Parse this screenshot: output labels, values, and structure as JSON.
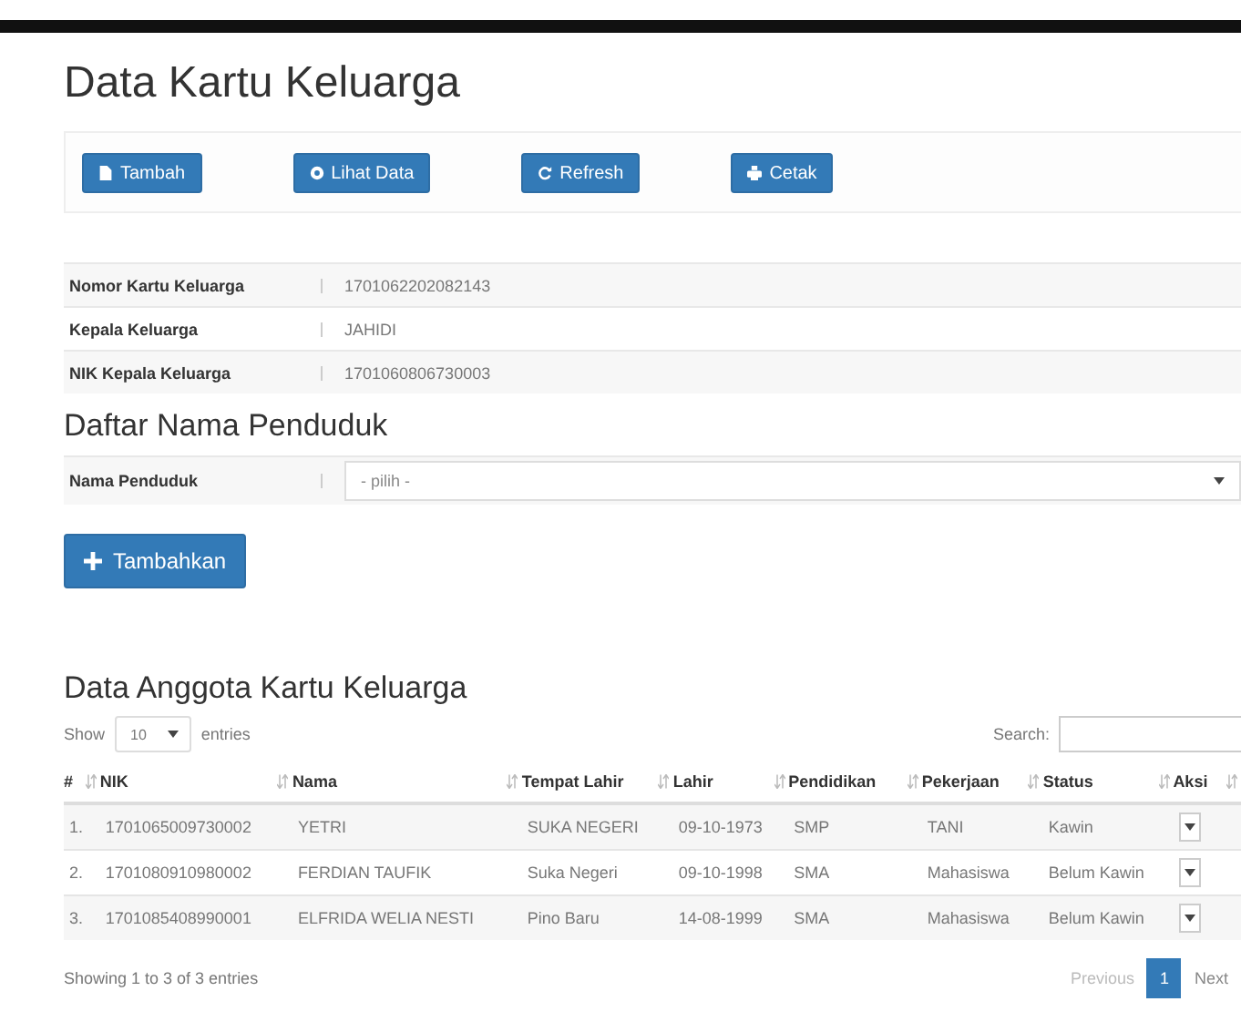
{
  "title": "Data Kartu Keluarga",
  "toolbar": [
    {
      "label": "Tambah"
    },
    {
      "label": "Lihat Data"
    },
    {
      "label": "Refresh"
    },
    {
      "label": "Cetak"
    }
  ],
  "info": [
    {
      "label": "Nomor Kartu Keluarga",
      "value": "1701062202082143"
    },
    {
      "label": "Kepala Keluarga",
      "value": "JAHIDI"
    },
    {
      "label": "NIK Kepala Keluarga",
      "value": "1701060806730003"
    }
  ],
  "resident_section": {
    "title": "Daftar Nama Penduduk",
    "label": "Nama Penduduk",
    "select_value": "- pilih -",
    "add_button": "Tambahkan"
  },
  "members": {
    "title": "Data Anggota Kartu Keluarga",
    "show_label": "Show",
    "page_size": "10",
    "entries_label": "entries",
    "search_label": "Search:",
    "columns": [
      "#",
      "NIK",
      "Nama",
      "Tempat Lahir",
      "Lahir",
      "Pendidikan",
      "Pekerjaan",
      "Status",
      "Aksi"
    ],
    "rows": [
      [
        "1.",
        "1701065009730002",
        "YETRI",
        "SUKA NEGERI",
        "09-10-1973",
        "SMP",
        "TANI",
        "Kawin"
      ],
      [
        "2.",
        "1701080910980002",
        "FERDIAN TAUFIK",
        "Suka Negeri",
        "09-10-1998",
        "SMA",
        "Mahasiswa",
        "Belum Kawin"
      ],
      [
        "3.",
        "1701085408990001",
        "ELFRIDA WELIA NESTI",
        "Pino Baru",
        "14-08-1999",
        "SMA",
        "Mahasiswa",
        "Belum Kawin"
      ]
    ],
    "summary": "Showing 1 to 3 of 3 entries",
    "pages": [
      {
        "label": "Previous",
        "selected": false,
        "disabled": true
      },
      {
        "label": "1",
        "selected": true,
        "disabled": false
      },
      {
        "label": "Next",
        "selected": false,
        "disabled": false
      }
    ]
  }
}
